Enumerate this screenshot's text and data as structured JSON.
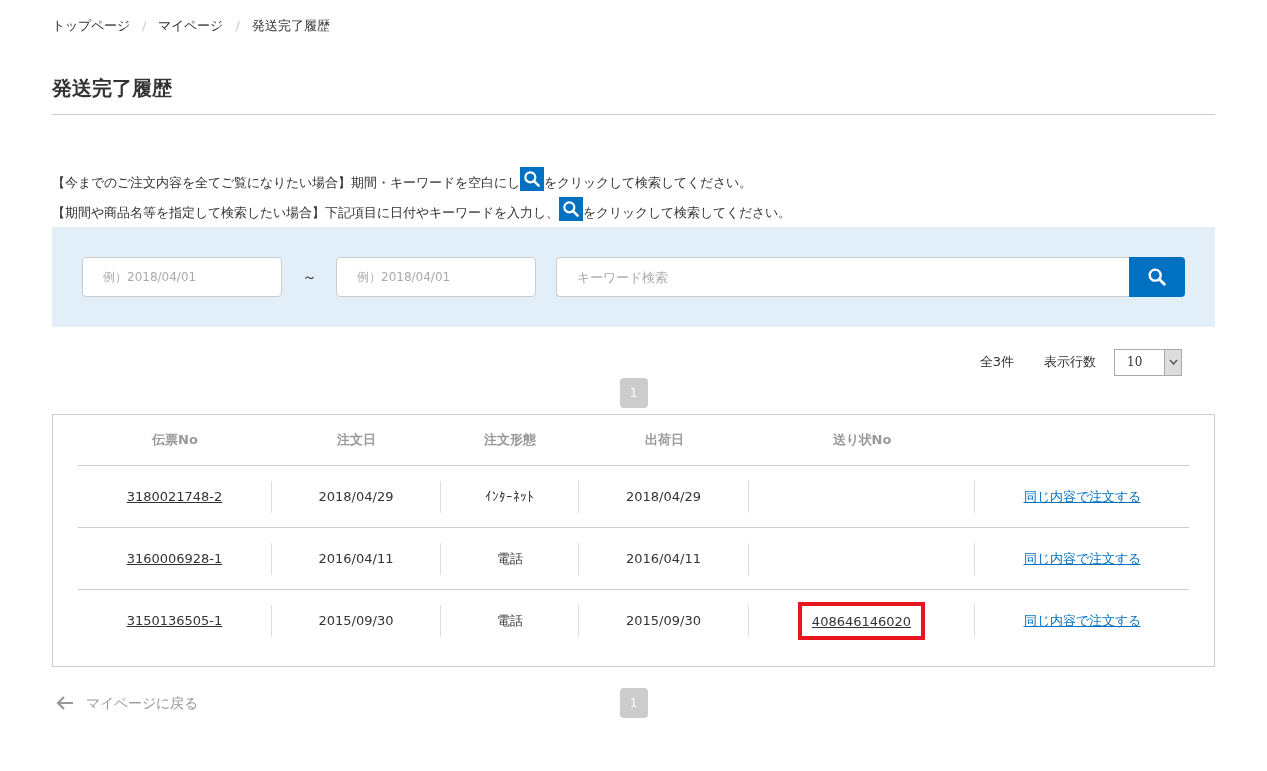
{
  "breadcrumb": [
    "トップページ",
    "マイページ",
    "発送完了履歴"
  ],
  "breadcrumb_separator": "/",
  "title": "発送完了履歴",
  "instructions": [
    {
      "before": "【今までのご注文内容を全てご覧になりたい場合】期間・キーワードを空白にし",
      "after": "をクリックして検索してください。"
    },
    {
      "before": "【期間や商品名等を指定して検索したい場合】下記項目に日付やキーワードを入力し、",
      "after": "をクリックして検索してください。"
    }
  ],
  "search": {
    "date_from_placeholder": "例）2018/04/01",
    "range_separator": "～",
    "date_to_placeholder": "例）2018/04/01",
    "keyword_placeholder": "キーワード検索"
  },
  "total": "全3件",
  "rows_per_page_label": "表示行数",
  "rows_per_page": "10",
  "pages_top": [
    {
      "label": "1",
      "selected": true
    }
  ],
  "table": {
    "columns": [
      "伝票No",
      "注文日",
      "注文形態",
      "出荷日",
      "送り状No"
    ],
    "rows": [
      {
        "slip_no": "3180021748-2",
        "order_date": "2018/04/29",
        "order_type": "ｲﾝﾀｰﾈｯﾄ",
        "ship_date": "2018/04/29",
        "highlighted": false,
        "action": "同じ内容で注文する"
      },
      {
        "slip_no": "3160006928-1",
        "order_date": "2016/04/11",
        "order_type": "電話",
        "ship_date": "2016/04/11",
        "highlighted": false,
        "action": "同じ内容で注文する"
      },
      {
        "slip_no": "3150136505-1",
        "order_date": "2015/09/30",
        "order_type": "電話",
        "ship_date": "2015/09/30",
        "tracking_no": "408646146020",
        "highlighted": true,
        "action": "同じ内容で注文する"
      }
    ]
  },
  "back_link": "マイページに戻る",
  "pages_bottom": [
    {
      "label": "1",
      "selected": true
    }
  ]
}
